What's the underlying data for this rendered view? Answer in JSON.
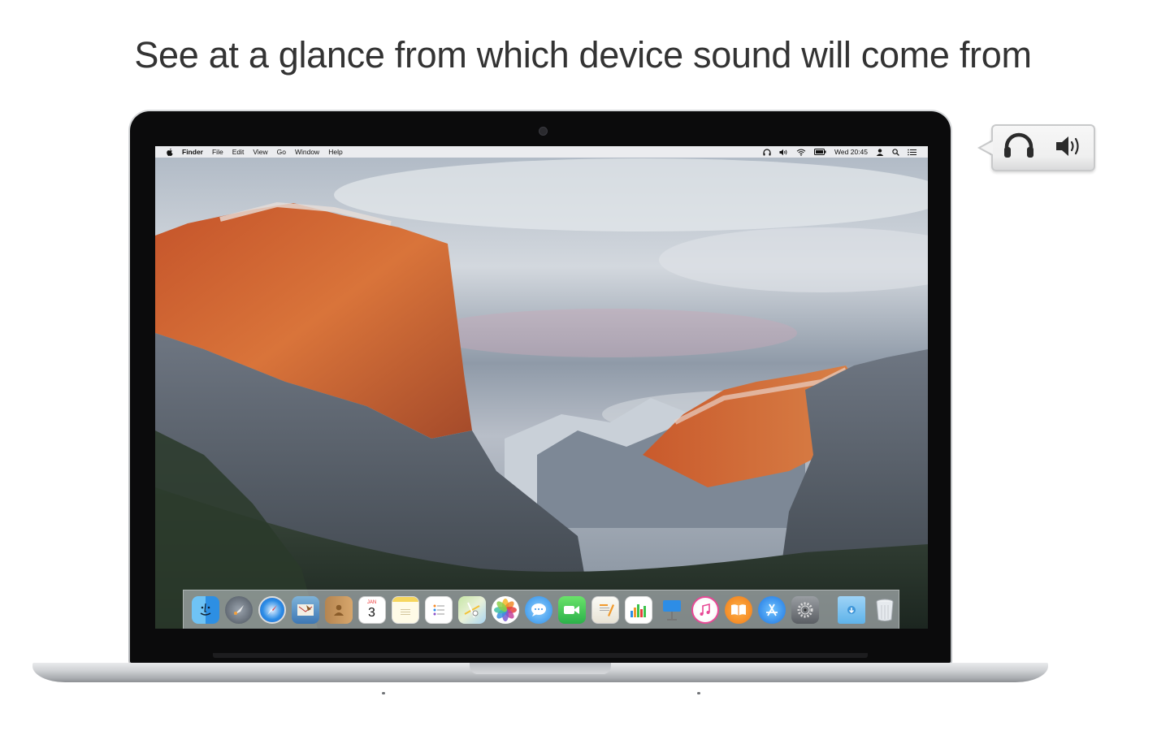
{
  "headline": "See at a glance from which device sound will come from",
  "menubar": {
    "apple": "",
    "app_name": "Finder",
    "menus": [
      "File",
      "Edit",
      "View",
      "Go",
      "Window",
      "Help"
    ],
    "status_icons": [
      "headphones-icon",
      "volume-icon",
      "wifi-icon",
      "battery-icon"
    ],
    "clock": "Wed 20:45",
    "extra_icons": [
      "user-icon",
      "spotlight-icon",
      "notification-center-icon"
    ]
  },
  "dock": {
    "apps": [
      "Finder",
      "Launchpad",
      "Safari",
      "Mail",
      "Contacts",
      "Calendar",
      "Notes",
      "Reminders",
      "Maps",
      "Photos",
      "Messages",
      "FaceTime",
      "Pages",
      "Numbers",
      "Keynote",
      "iTunes",
      "iBooks",
      "App Store",
      "System Preferences"
    ],
    "calendar_month": "JAN",
    "calendar_day": "3",
    "trailing": [
      "Downloads",
      "Trash"
    ]
  },
  "callout": {
    "icons": [
      "headphones-icon",
      "speaker-volume-icon"
    ]
  },
  "colors": {
    "headline": "#333333",
    "bezel": "#0b0b0c",
    "aluminum": "#cfd1d4"
  }
}
